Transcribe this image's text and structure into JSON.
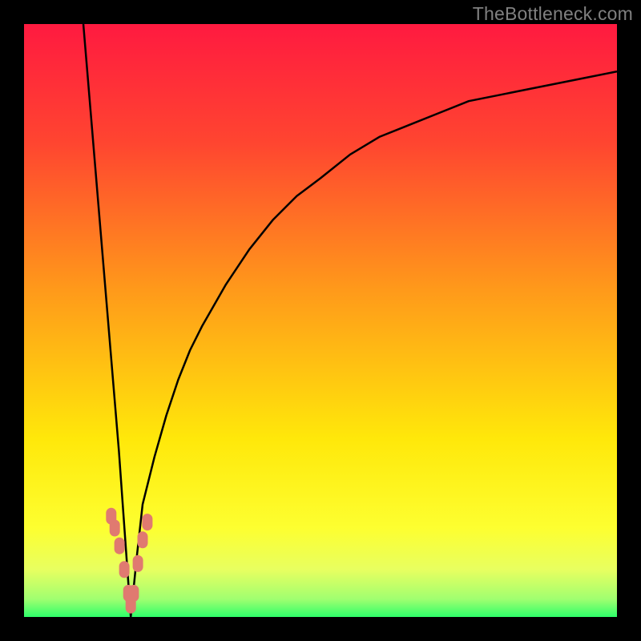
{
  "watermark": "TheBottleneck.com",
  "colors": {
    "frame": "#000000",
    "curve": "#000000",
    "marker_fill": "#e07a70",
    "marker_stroke": "#e07a70",
    "gradient_stops": [
      {
        "pos": 0.0,
        "color": "#ff1a40"
      },
      {
        "pos": 0.2,
        "color": "#ff4530"
      },
      {
        "pos": 0.45,
        "color": "#ff9a1a"
      },
      {
        "pos": 0.7,
        "color": "#ffe80a"
      },
      {
        "pos": 0.85,
        "color": "#fdff30"
      },
      {
        "pos": 0.92,
        "color": "#e8ff60"
      },
      {
        "pos": 0.97,
        "color": "#a0ff70"
      },
      {
        "pos": 1.0,
        "color": "#2eff6a"
      }
    ]
  },
  "chart_data": {
    "type": "line",
    "title": "",
    "xlabel": "",
    "ylabel": "",
    "xlim": [
      0,
      100
    ],
    "ylim": [
      0,
      100
    ],
    "x_min_at": 18,
    "series": [
      {
        "name": "bottleneck-curve",
        "x": [
          10,
          11,
          12,
          13,
          14,
          15,
          16,
          17,
          18,
          19,
          20,
          22,
          24,
          26,
          28,
          30,
          34,
          38,
          42,
          46,
          50,
          55,
          60,
          65,
          70,
          75,
          80,
          85,
          90,
          95,
          100
        ],
        "y": [
          100,
          88,
          76,
          64,
          52,
          40,
          28,
          14,
          0,
          10,
          19,
          27,
          34,
          40,
          45,
          49,
          56,
          62,
          67,
          71,
          74,
          78,
          81,
          83,
          85,
          87,
          88,
          89,
          90,
          91,
          92
        ]
      }
    ],
    "markers": {
      "name": "highlighted-points",
      "x": [
        14.7,
        15.3,
        16.1,
        16.9,
        17.6,
        18.0,
        18.5,
        19.2,
        20.0,
        20.8
      ],
      "y": [
        17,
        15,
        12,
        8,
        4,
        2,
        4,
        9,
        13,
        16
      ]
    }
  }
}
